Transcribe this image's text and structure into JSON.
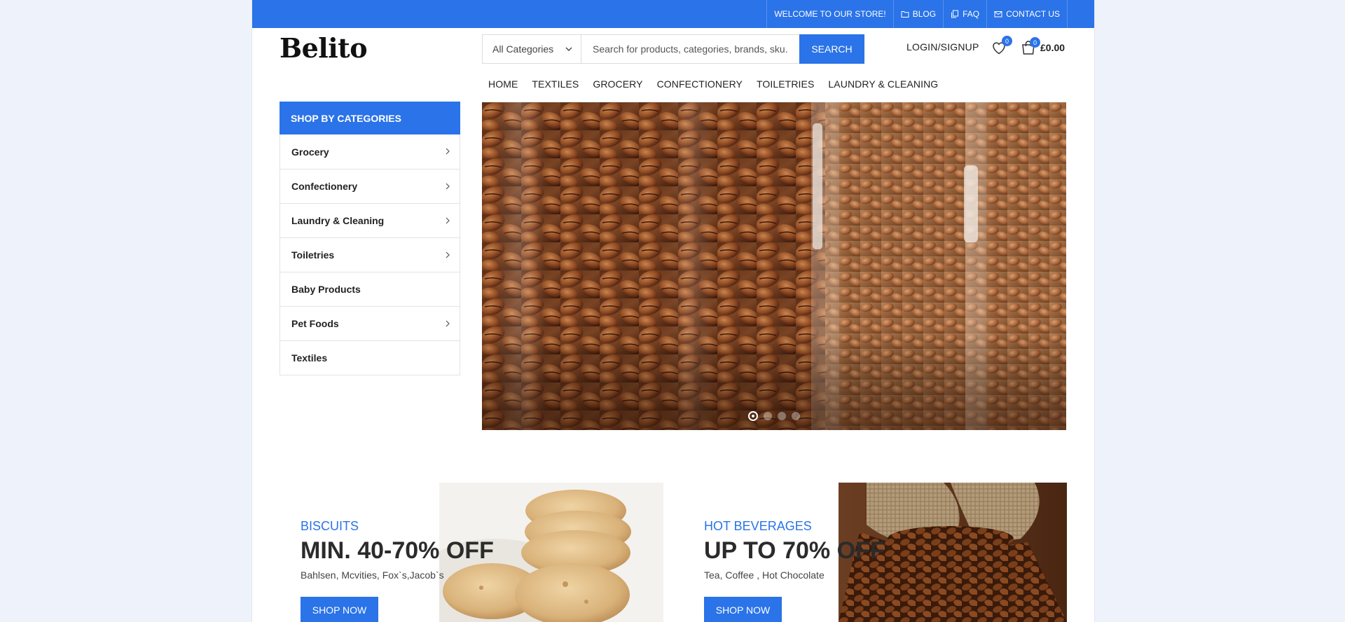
{
  "topbar": {
    "welcome": "WELCOME TO OUR STORE!",
    "blog": "BLOG",
    "faq": "FAQ",
    "contact": "CONTACT US"
  },
  "header": {
    "logo": "Belito",
    "category_select": "All Categories",
    "search_placeholder": "Search for products, categories, brands, sku...",
    "search_button": "SEARCH",
    "login": "LOGIN/SIGNUP",
    "wishlist_count": "0",
    "cart_count": "0",
    "cart_total": "£0.00"
  },
  "nav": {
    "items": [
      "HOME",
      "TEXTILES",
      "GROCERY",
      "CONFECTIONERY",
      "TOILETRIES",
      "LAUNDRY & CLEANING"
    ]
  },
  "categories": {
    "title": "SHOP BY CATEGORIES",
    "items": [
      "Grocery",
      "Confectionery",
      "Laundry & Cleaning",
      "Toiletries",
      "Baby Products",
      "Pet Foods",
      "Textiles"
    ]
  },
  "slider": {
    "slide_count": 4,
    "active_slide": 1
  },
  "promos": [
    {
      "category": "BISCUITS",
      "headline": "MIN. 40-70% OFF",
      "brands": "Bahlsen, Mcvities, Fox`s,Jacob`s",
      "button": "SHOP NOW"
    },
    {
      "category": "HOT BEVERAGES",
      "headline": "UP TO 70% OFF",
      "brands": "Tea, Coffee , Hot Chocolate",
      "button": "SHOP NOW"
    }
  ],
  "colors": {
    "accent": "#2a73e8",
    "text": "#222222",
    "background": "#eef2fb"
  }
}
